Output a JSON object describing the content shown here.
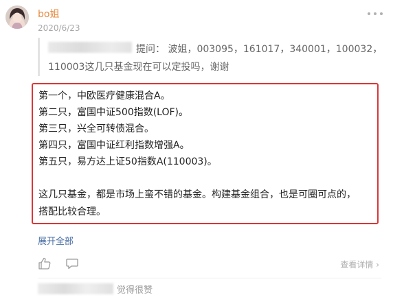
{
  "comment": {
    "author": "bo姐",
    "date": "2020/6/23",
    "quote": {
      "question": "提问：  波姐，003095，161017，340001，100032，",
      "question_cont": "110003这几只基金现在可以定投吗，谢谢"
    },
    "reply_lines": [
      "第一个，中欧医疗健康混合A。",
      "第二只，富国中证500指数(LOF)。",
      "第三只，兴全可转债混合。",
      "第四只，富国中证红利指数增强A。",
      "第五只，易方达上证50指数A(110003)。",
      "",
      "这几只基金，都是市场上蛮不错的基金。构建基金组合，也是可圈可点的，",
      "搭配比较合理。"
    ],
    "expand_label": "展开全部",
    "detail_label": "查看详情 ›",
    "like_text": "觉得很赞"
  },
  "colors": {
    "author": "#e8893d",
    "highlight_border": "#d93636",
    "link": "#4a6fa5"
  },
  "icons": [
    "avatar",
    "more-icon",
    "thumbs-up-icon",
    "comment-icon"
  ]
}
